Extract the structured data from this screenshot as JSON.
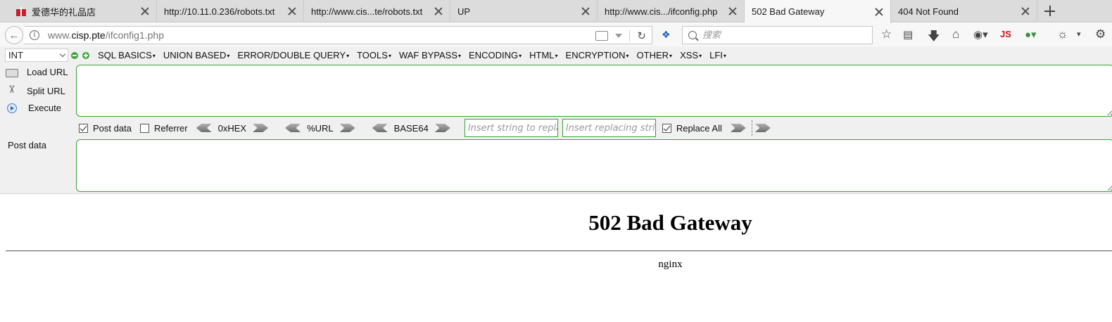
{
  "tabs": [
    {
      "title": "爱德华的礼品店",
      "active": false
    },
    {
      "title": "http://10.11.0.236/robots.txt",
      "active": false
    },
    {
      "title": "http://www.cis...te/robots.txt",
      "active": false
    },
    {
      "title": "UP",
      "active": false
    },
    {
      "title": "http://www.cis.../ifconfig.php",
      "active": false
    },
    {
      "title": "502 Bad Gateway",
      "active": true
    },
    {
      "title": "404 Not Found",
      "active": false
    }
  ],
  "navbar": {
    "url_prefix": "www.",
    "url_host": "cisp.pte",
    "url_path": "/ifconfig1.php",
    "search_placeholder": "搜索",
    "js_label": "JS"
  },
  "hackbar": {
    "mode_select": "INT",
    "menus": [
      "SQL BASICS",
      "UNION BASED",
      "ERROR/DOUBLE QUERY",
      "TOOLS",
      "WAF BYPASS",
      "ENCODING",
      "HTML",
      "ENCRYPTION",
      "OTHER",
      "XSS",
      "LFI"
    ],
    "load_url": "Load URL",
    "split_url": "Split URL",
    "execute": "Execute",
    "url_value": "",
    "post_data_checkbox": {
      "label": "Post data",
      "checked": true
    },
    "referrer_checkbox": {
      "label": "Referrer",
      "checked": false
    },
    "hex_label": "0xHEX",
    "url_enc_label": "%URL",
    "base64_label": "BASE64",
    "replace_placeholder": "Insert string to replace",
    "replacing_placeholder": "Insert replacing string",
    "replace_all": {
      "label": "Replace All",
      "checked": true
    },
    "post_data_label": "Post data",
    "post_value": ""
  },
  "page": {
    "heading": "502 Bad Gateway",
    "server": "nginx"
  }
}
